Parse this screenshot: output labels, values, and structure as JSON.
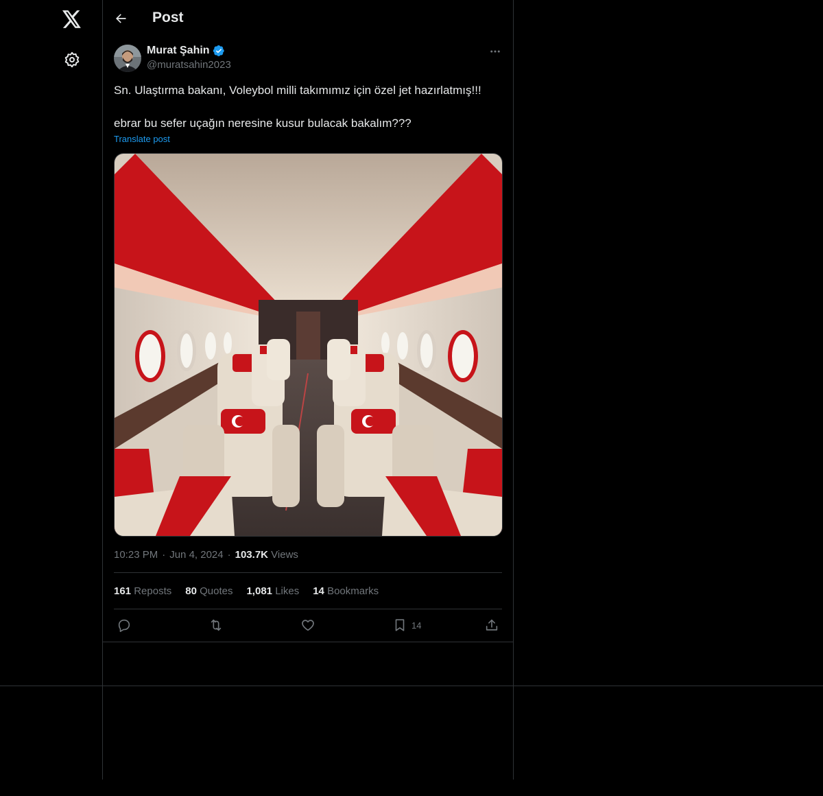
{
  "header": {
    "title": "Post"
  },
  "author": {
    "name": "Murat Şahin",
    "handle": "@muratsahin2023"
  },
  "tweet": {
    "line1": "Sn. Ulaştırma bakanı, Voleybol milli takımımız için özel jet hazırlatmış!!!",
    "line2": "ebrar bu sefer uçağın neresine kusur bulacak bakalım???",
    "translate_label": "Translate post"
  },
  "meta": {
    "time": "10:23 PM",
    "sep": "·",
    "date": "Jun 4, 2024",
    "views_count": "103.7K",
    "views_label": "Views"
  },
  "stats": [
    {
      "count": "161",
      "label": "Reposts"
    },
    {
      "count": "80",
      "label": "Quotes"
    },
    {
      "count": "1,081",
      "label": "Likes"
    },
    {
      "count": "14",
      "label": "Bookmarks"
    }
  ],
  "actions": {
    "bookmark_count": "14"
  },
  "icons": [
    "x-logo-icon",
    "settings-icon",
    "back-arrow-icon",
    "verified-badge-icon",
    "more-options-icon",
    "reply-icon",
    "repost-icon",
    "like-icon",
    "bookmark-icon",
    "share-icon"
  ],
  "colors": {
    "accent": "#1d9bf0",
    "text": "#e7e9ea",
    "muted": "#71767b",
    "border": "#2f3336",
    "background": "#000000"
  }
}
